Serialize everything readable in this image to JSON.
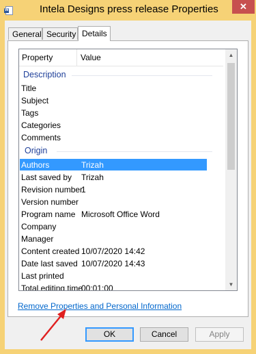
{
  "window": {
    "title": "Intela Designs press release Properties",
    "icon": "word-document-icon",
    "close_symbol": "✕"
  },
  "tabs": [
    {
      "label": "General",
      "active": false
    },
    {
      "label": "Security",
      "active": false
    },
    {
      "label": "Details",
      "active": true
    }
  ],
  "list": {
    "columns": [
      "Property",
      "Value"
    ],
    "groups": [
      {
        "name": "Description",
        "rows": [
          {
            "key": "Title",
            "value": ""
          },
          {
            "key": "Subject",
            "value": ""
          },
          {
            "key": "Tags",
            "value": ""
          },
          {
            "key": "Categories",
            "value": ""
          },
          {
            "key": "Comments",
            "value": ""
          }
        ]
      },
      {
        "name": "Origin",
        "rows": [
          {
            "key": "Authors",
            "value": "Trizah",
            "selected": true
          },
          {
            "key": "Last saved by",
            "value": "Trizah"
          },
          {
            "key": "Revision number",
            "value": "1"
          },
          {
            "key": "Version number",
            "value": ""
          },
          {
            "key": "Program name",
            "value": "Microsoft Office Word"
          },
          {
            "key": "Company",
            "value": ""
          },
          {
            "key": "Manager",
            "value": ""
          },
          {
            "key": "Content created",
            "value": "10/07/2020 14:42"
          },
          {
            "key": "Date last saved",
            "value": "10/07/2020 14:43"
          },
          {
            "key": "Last printed",
            "value": ""
          },
          {
            "key": "Total editing time",
            "value": "00:01:00"
          }
        ]
      }
    ]
  },
  "remove_link": "Remove Properties and Personal Information",
  "buttons": {
    "ok": "OK",
    "cancel": "Cancel",
    "apply": "Apply"
  },
  "colors": {
    "title_bar": "#f6d276",
    "selection": "#3399ff",
    "group_header": "#1e3f99",
    "link": "#0066cc",
    "annotation_arrow": "#e02020"
  }
}
